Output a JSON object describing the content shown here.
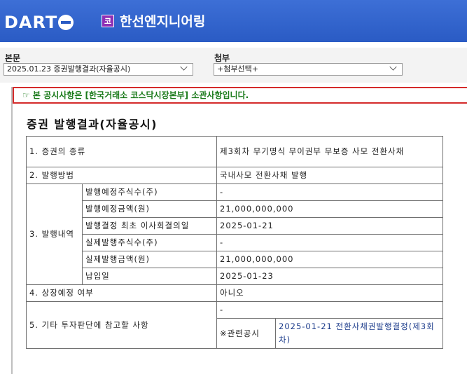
{
  "header": {
    "logo_text": "DART",
    "badge": "코",
    "company": "한선엔지니어링"
  },
  "selectors": {
    "body_label": "본문",
    "body_value": "2025.01.23  증권발행결과(자율공시)",
    "attach_label": "첨부",
    "attach_value": "+첨부선택+"
  },
  "notice": "☞ 본 공시사항은 [한국거래소 코스닥시장본부] 소관사항입니다.",
  "doc_title": "증권 발행결과(자율공시)",
  "table": {
    "r1_label": "1. 증권의 종류",
    "r1_value": "제3회차 무기명식 무이권부 무보증 사모 전환사채",
    "r2_label": "2. 발행방법",
    "r2_value": "국내사모 전환사채 발행",
    "r3_label": "3. 발행내역",
    "r3_items": [
      {
        "label": "발행예정주식수(주)",
        "value": "-"
      },
      {
        "label": "발행예정금액(원)",
        "value": "21,000,000,000"
      },
      {
        "label": "발행결정 최초 이사회결의일",
        "value": "2025-01-21"
      },
      {
        "label": "실제발행주식수(주)",
        "value": "-"
      },
      {
        "label": "실제발행금액(원)",
        "value": "21,000,000,000"
      },
      {
        "label": "납입일",
        "value": "2025-01-23"
      }
    ],
    "r4_label": "4. 상장예정 여부",
    "r4_value": "아니오",
    "r5_label": "5. 기타 투자판단에 참고할 사항",
    "r5_value": "-",
    "r5_ref_label": "※관련공시",
    "r5_ref_link": "2025-01-21 전환사채권발행결정(제3회차)"
  }
}
